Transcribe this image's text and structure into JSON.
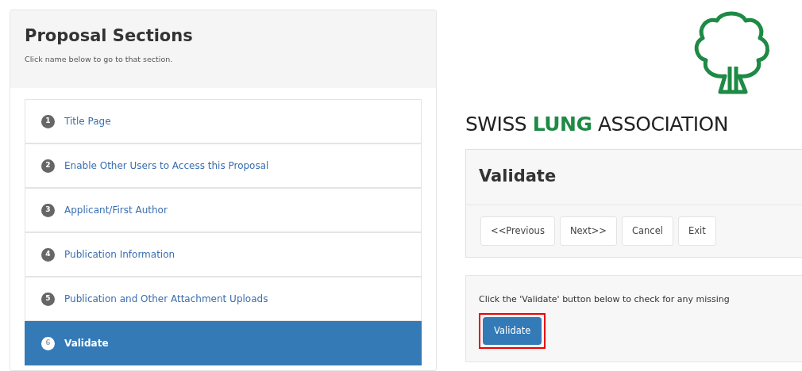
{
  "sidebar": {
    "title": "Proposal Sections",
    "subtitle": "Click name below to go to that section.",
    "items": [
      {
        "number": "1",
        "label": "Title Page",
        "selected": false
      },
      {
        "number": "2",
        "label": "Enable Other Users to Access this Proposal",
        "selected": false
      },
      {
        "number": "3",
        "label": "Applicant/First Author",
        "selected": false
      },
      {
        "number": "4",
        "label": "Publication Information",
        "selected": false
      },
      {
        "number": "5",
        "label": "Publication and Other Attachment Uploads",
        "selected": false
      },
      {
        "number": "6",
        "label": "Validate",
        "selected": true
      }
    ]
  },
  "logo": {
    "words": [
      {
        "text": "SWISS",
        "accent": false
      },
      {
        "text": "LUNG",
        "accent": true
      },
      {
        "text": "ASSOCIATION",
        "accent": false
      }
    ]
  },
  "section_panel": {
    "title": "Validate",
    "buttons": [
      "<<Previous",
      "Next>>",
      "Cancel",
      "Exit"
    ]
  },
  "validate_panel": {
    "instruction": "Click the 'Validate' button below to check for any missing",
    "button": {
      "label": "Validate",
      "highlighted": true
    }
  }
}
